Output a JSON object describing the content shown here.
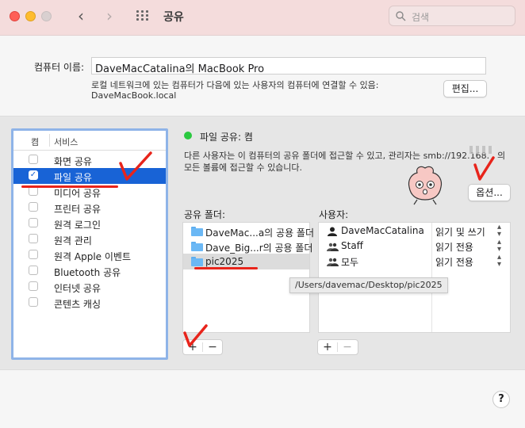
{
  "window": {
    "title": "공유",
    "search_placeholder": "검색",
    "nav_back": "‹",
    "nav_forward": "›"
  },
  "computer_name": {
    "label": "컴퓨터 이름:",
    "value": "DaveMacCatalina의 MacBook Pro",
    "description": "로컬 네트워크에 있는 컴퓨터가 다음에 있는 사용자의 컴퓨터에 연결할 수 있음:",
    "local_address": "DaveMacBook.local",
    "edit_button": "편집..."
  },
  "services": {
    "col_on": "켬",
    "col_service": "서비스",
    "items": [
      {
        "label": "화면 공유",
        "checked": false,
        "selected": false
      },
      {
        "label": "파일 공유",
        "checked": true,
        "selected": true
      },
      {
        "label": "미디어 공유",
        "checked": false,
        "selected": false
      },
      {
        "label": "프린터 공유",
        "checked": false,
        "selected": false
      },
      {
        "label": "원격 로그인",
        "checked": false,
        "selected": false
      },
      {
        "label": "원격 관리",
        "checked": false,
        "selected": false
      },
      {
        "label": "원격 Apple 이벤트",
        "checked": false,
        "selected": false
      },
      {
        "label": "Bluetooth 공유",
        "checked": false,
        "selected": false
      },
      {
        "label": "인터넷 공유",
        "checked": false,
        "selected": false
      },
      {
        "label": "콘텐츠 캐싱",
        "checked": false,
        "selected": false
      }
    ]
  },
  "file_sharing": {
    "status": "파일 공유: 켬",
    "status_color": "#2bc940",
    "description_line1": "다른 사용자는 이 컴퓨터의 공유 폴더에 접근할 수 있고, 관리자는 smb://192.168.",
    "description_line1_end": "의",
    "description_line2": "모든 볼륨에 접근할 수 있습니다.",
    "options_button": "옵션...",
    "shared_folders_label": "공유 폴더:",
    "users_label": "사용자:",
    "folders": [
      {
        "name": "DaveMac...a의 공용 폴더",
        "selected": false
      },
      {
        "name": "Dave_Big...r의 공용 폴더",
        "selected": false
      },
      {
        "name": "pic2025",
        "selected": true
      }
    ],
    "users": [
      {
        "name": "DaveMacCatalina",
        "icon": "person-icon",
        "permission": "읽기 및 쓰기"
      },
      {
        "name": "Staff",
        "icon": "group-icon",
        "permission": "읽기 전용"
      },
      {
        "name": "모두",
        "icon": "group-icon",
        "permission": "읽기 전용"
      }
    ],
    "tooltip": "/Users/davemac/Desktop/pic2025",
    "add": "+",
    "remove": "−"
  },
  "help": "?"
}
